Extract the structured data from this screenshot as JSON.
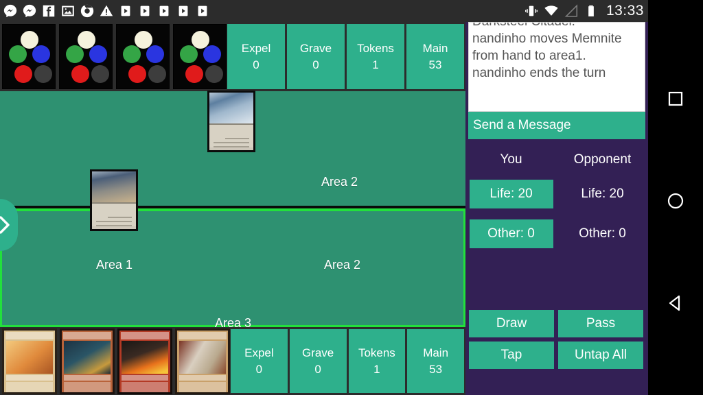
{
  "status_bar": {
    "clock": "13:33",
    "left_icons": [
      {
        "name": "messenger-icon"
      },
      {
        "name": "messenger-icon"
      },
      {
        "name": "facebook-icon"
      },
      {
        "name": "gallery-icon"
      },
      {
        "name": "chrome-icon"
      },
      {
        "name": "warning-icon"
      },
      {
        "name": "play-store-icon"
      },
      {
        "name": "play-store-icon"
      },
      {
        "name": "play-store-icon"
      },
      {
        "name": "play-store-icon"
      },
      {
        "name": "play-store-icon"
      }
    ],
    "right_icons": [
      {
        "name": "vibrate-icon"
      },
      {
        "name": "wifi-icon"
      },
      {
        "name": "signal-icon"
      },
      {
        "name": "battery-icon"
      }
    ]
  },
  "nav_bar": {
    "recents_label": "recents",
    "home_label": "home",
    "back_label": "back"
  },
  "colors": {
    "board_green": "#2E9171",
    "button_teal": "#2EB08C",
    "panel_purple": "#332055",
    "highlight_green": "#22E03C",
    "status_bar": "#2C2C2C"
  },
  "opponent_zones": [
    {
      "label": "Expel",
      "count": "0"
    },
    {
      "label": "Grave",
      "count": "0"
    },
    {
      "label": "Tokens",
      "count": "1"
    },
    {
      "label": "Main",
      "count": "53"
    }
  ],
  "player_zones": [
    {
      "label": "Expel",
      "count": "0"
    },
    {
      "label": "Grave",
      "count": "0"
    },
    {
      "label": "Tokens",
      "count": "1"
    },
    {
      "label": "Main",
      "count": "53"
    }
  ],
  "opponent_library_backs": 4,
  "battlefield": {
    "opponent": {
      "area_label": "Area 2",
      "cards": [
        {
          "name": "opponent-card-1"
        }
      ]
    },
    "player": {
      "area1_label": "Area 1",
      "area2_label": "Area 2",
      "area3_label": "Area 3",
      "cards": [
        {
          "name": "player-card-1"
        }
      ]
    },
    "handle_icon": "chevron-right-icon"
  },
  "hand": {
    "cards": [
      {
        "name": "hand-card-1"
      },
      {
        "name": "hand-card-2"
      },
      {
        "name": "hand-card-3"
      },
      {
        "name": "hand-card-4"
      }
    ]
  },
  "chat": {
    "messages": [
      "Darksteel Citadel.",
      "nandinho moves Memnite from hand to area1.",
      "nandinho ends the turn"
    ],
    "send_placeholder": "Send a Message"
  },
  "players": {
    "you_header": "You",
    "opponent_header": "Opponent",
    "you_life": "Life: 20",
    "opponent_life": "Life: 20",
    "you_other": "Other: 0",
    "opponent_other": "Other: 0"
  },
  "actions": [
    {
      "label": "Draw"
    },
    {
      "label": "Pass"
    },
    {
      "label": "Tap"
    },
    {
      "label": "Untap All"
    }
  ]
}
